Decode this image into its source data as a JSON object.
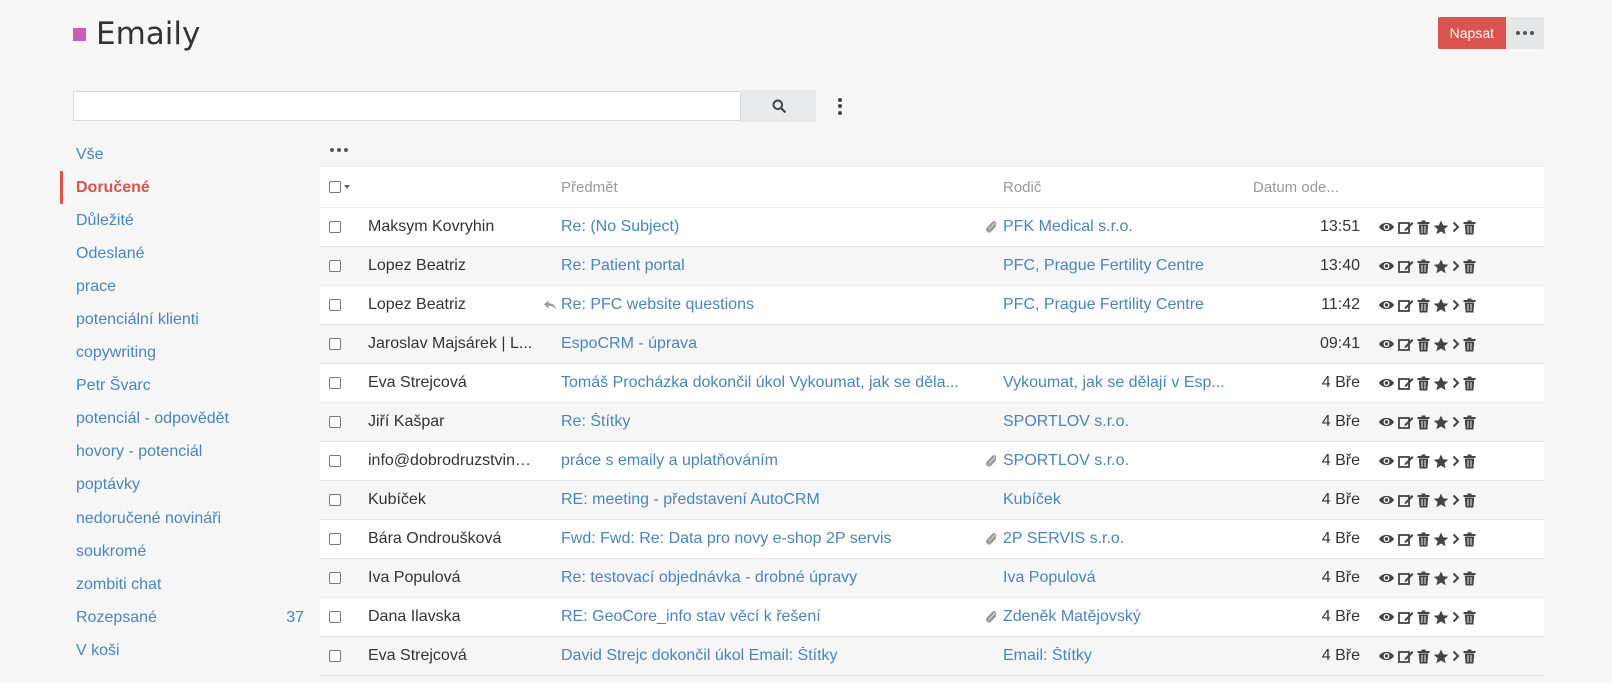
{
  "header": {
    "title": "Emaily",
    "title_color": "#c75fb6"
  },
  "actions": {
    "compose_label": "Napsat",
    "compose_color": "#d9534f"
  },
  "search": {
    "value": "",
    "placeholder": ""
  },
  "sidebar": {
    "folders": [
      {
        "label": "Vše",
        "count": ""
      },
      {
        "label": "Doručené",
        "count": "",
        "active": true
      },
      {
        "label": "Důležité",
        "count": ""
      },
      {
        "label": "Odeslané",
        "count": ""
      },
      {
        "label": "prace",
        "count": ""
      },
      {
        "label": "potenciální klienti",
        "count": ""
      },
      {
        "label": "copywriting",
        "count": ""
      },
      {
        "label": "Petr Švarc",
        "count": ""
      },
      {
        "label": "potenciál - odpovědět",
        "count": ""
      },
      {
        "label": "hovory - potenciál",
        "count": ""
      },
      {
        "label": "poptávky",
        "count": ""
      },
      {
        "label": "nedoručené novináři",
        "count": ""
      },
      {
        "label": "soukromé",
        "count": ""
      },
      {
        "label": "zombiti chat",
        "count": ""
      },
      {
        "label": "Rozepsané",
        "count": "37"
      },
      {
        "label": "V koši",
        "count": ""
      }
    ]
  },
  "list": {
    "columns": {
      "subject": "Předmět",
      "parent": "Rodič",
      "date": "Datum ode..."
    },
    "rows": [
      {
        "from": "Maksym Kovryhin",
        "subject": "Re: (No Subject)",
        "parent": "PFK Medical s.r.o.",
        "date": "13:51",
        "attachment": true,
        "replied": false
      },
      {
        "from": "Lopez Beatriz",
        "subject": "Re: Patient portal",
        "parent": "PFC, Prague Fertility Centre",
        "date": "13:40",
        "attachment": false,
        "replied": false
      },
      {
        "from": "Lopez Beatriz",
        "subject": "Re: PFC website questions",
        "parent": "PFC, Prague Fertility Centre",
        "date": "11:42",
        "attachment": false,
        "replied": true
      },
      {
        "from": "Jaroslav Majsárek | L...",
        "subject": "EspoCRM - úprava",
        "parent": "",
        "date": "09:41",
        "attachment": false,
        "replied": false
      },
      {
        "from": "Eva Strejcová",
        "subject": "Tomáš Procházka dokončil úkol Vykoumat, jak se děla...",
        "parent": "Vykoumat, jak se dělají v Esp...",
        "date": "4 Bře",
        "attachment": false,
        "replied": false
      },
      {
        "from": "Jiří Kašpar",
        "subject": "Re: Štítky",
        "parent": "SPORTLOV s.r.o.",
        "date": "4 Bře",
        "attachment": false,
        "replied": false
      },
      {
        "from": "info@dobrodruzstvina...",
        "subject": "práce s emaily a uplatňováním",
        "parent": "SPORTLOV s.r.o.",
        "date": "4 Bře",
        "attachment": true,
        "replied": false
      },
      {
        "from": "Kubíček",
        "subject": "RE: meeting - představení AutoCRM",
        "parent": "Kubíček",
        "date": "4 Bře",
        "attachment": false,
        "replied": false
      },
      {
        "from": "Bára Ondroušková",
        "subject": "Fwd: Fwd: Re: Data pro novy e-shop 2P servis",
        "parent": "2P SERVIS s.r.o.",
        "date": "4 Bře",
        "attachment": true,
        "replied": false
      },
      {
        "from": "Iva Populová",
        "subject": "Re: testovací objednávka - drobné úpravy",
        "parent": "Iva Populová",
        "date": "4 Bře",
        "attachment": false,
        "replied": false
      },
      {
        "from": "Dana Ilavska",
        "subject": "RE: GeoCore_info stav věcí k řešení",
        "parent": "Zdeněk Matějovský",
        "date": "4 Bře",
        "attachment": true,
        "replied": false
      },
      {
        "from": "Eva Strejcová",
        "subject": "David Strejc dokončil úkol Email: Štítky",
        "parent": "Email: Štítky",
        "date": "4 Bře",
        "attachment": false,
        "replied": false
      }
    ]
  },
  "icons": [
    "search-icon",
    "more-icon",
    "menu-dots-icon",
    "checkbox-icon",
    "paperclip-icon",
    "reply-icon",
    "eye-icon",
    "edit-icon",
    "trash-icon",
    "star-icon",
    "chevron-right-icon"
  ]
}
